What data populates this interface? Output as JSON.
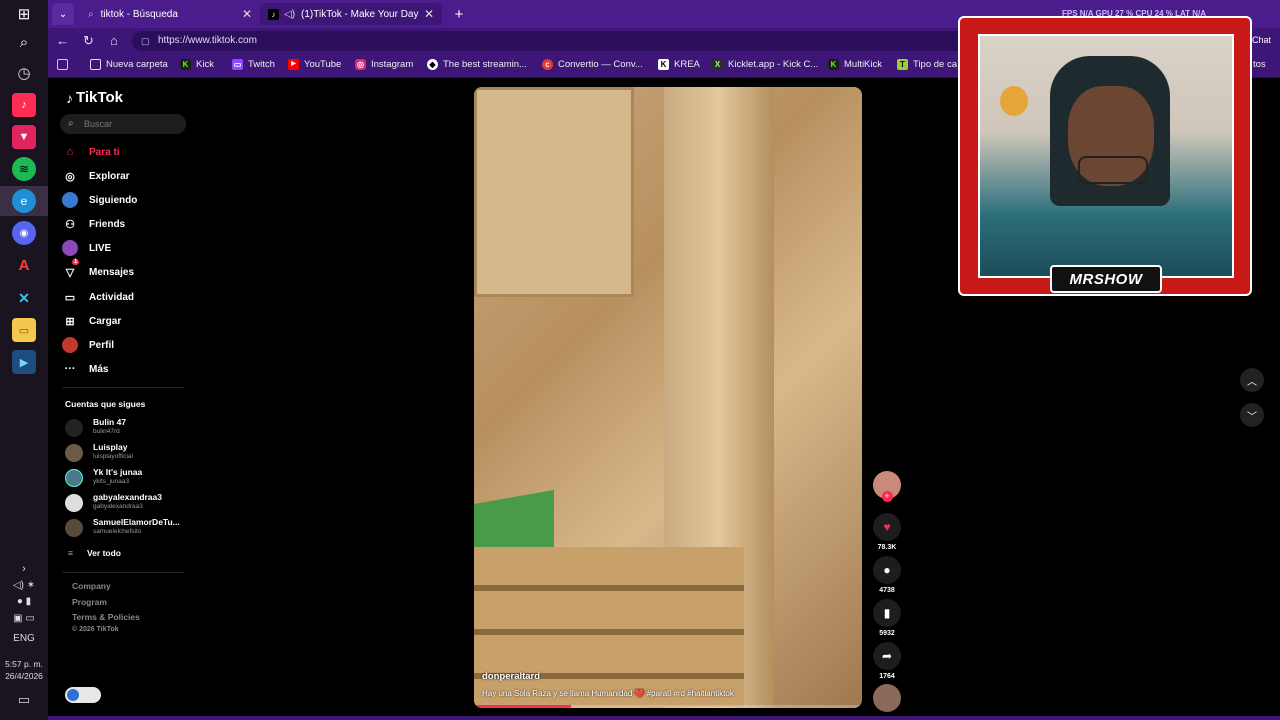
{
  "taskbar": {
    "language": "ENG",
    "time": "5:57 p. m.",
    "date": "26/4/2026"
  },
  "browser": {
    "tabs": [
      {
        "label": "tiktok - Búsqueda"
      },
      {
        "label": "(1)TikTok - Make Your Day"
      }
    ],
    "url": "https://www.tiktok.com",
    "bookmarks": [
      {
        "label": "Nueva carpeta"
      },
      {
        "label": "Kick"
      },
      {
        "label": "Twitch"
      },
      {
        "label": "YouTube"
      },
      {
        "label": "Instagram"
      },
      {
        "label": "The best streamin..."
      },
      {
        "label": "Convertio — Conv..."
      },
      {
        "label": "KREA"
      },
      {
        "label": "Kicklet.app - Kick C..."
      },
      {
        "label": "MultiKick"
      },
      {
        "label": "Tipo de ca"
      }
    ],
    "overflow_right": "Chat",
    "overflow_right2": "tos"
  },
  "tiktok": {
    "logo": "TikTok",
    "search_placeholder": "Buscar",
    "nav": [
      {
        "label": "Para ti"
      },
      {
        "label": "Explorar"
      },
      {
        "label": "Siguiendo"
      },
      {
        "label": "Friends"
      },
      {
        "label": "LIVE"
      },
      {
        "label": "Mensajes",
        "badge": "1"
      },
      {
        "label": "Actividad"
      },
      {
        "label": "Cargar"
      },
      {
        "label": "Perfil"
      },
      {
        "label": "Más"
      }
    ],
    "following_title": "Cuentas que sigues",
    "accounts": [
      {
        "name": "Bulin 47",
        "handle": "bulin47rd"
      },
      {
        "name": "Luisplay",
        "handle": "luisplayofficial"
      },
      {
        "name": "Yk It's junaa",
        "handle": "ykits_junaa3"
      },
      {
        "name": "gabyalexandraa3",
        "handle": "gabyalexandraa3"
      },
      {
        "name": "SamuelElamorDeTu...",
        "handle": "samuelelchefsito"
      }
    ],
    "see_all": "Ver todo",
    "footer": [
      "Company",
      "Program",
      "Terms & Policies",
      "© 2026 TikTok"
    ],
    "video": {
      "author": "donperaltard",
      "caption": "Hay una Sola Raza y se llama Humanidad ❤️ #parati #rd #haitiantiktok",
      "progress": 0.25
    },
    "actions": {
      "likes": "78.3K",
      "comments": "4738",
      "saves": "5932",
      "shares": "1764"
    }
  },
  "overlay": {
    "stats": "FPS  N/A   GPU  27 %   CPU  24 %   LAT  N/A",
    "streamer_logo": "MRSHOW"
  }
}
